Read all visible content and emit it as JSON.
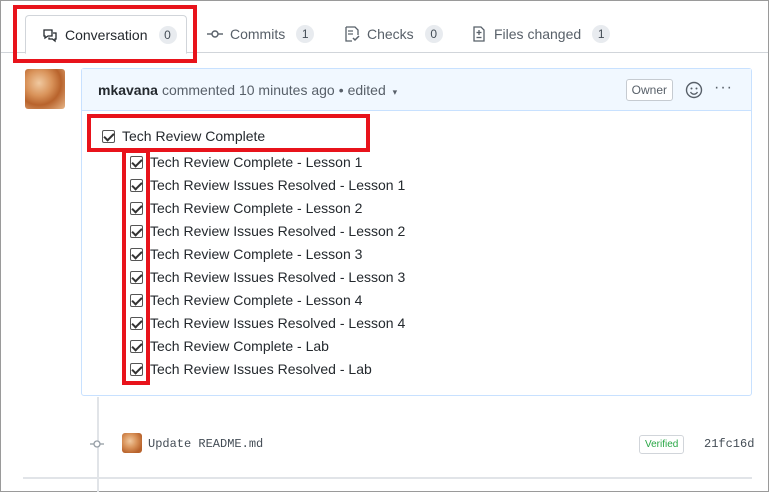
{
  "tabs": [
    {
      "label": "Conversation",
      "count": "0",
      "icon": "comment-discussion-icon"
    },
    {
      "label": "Commits",
      "count": "1",
      "icon": "git-commit-icon"
    },
    {
      "label": "Checks",
      "count": "0",
      "icon": "checklist-icon"
    },
    {
      "label": "Files changed",
      "count": "1",
      "icon": "file-diff-icon"
    }
  ],
  "comment": {
    "author": "mkavana",
    "meta": "commented 10 minutes ago",
    "separator": "•",
    "edited": "edited",
    "role_badge": "Owner",
    "dots": "···",
    "parent_task": {
      "label": "Tech Review Complete",
      "checked": true
    },
    "sub_tasks": [
      {
        "label": "Tech Review Complete - Lesson 1",
        "checked": true
      },
      {
        "label": "Tech Review Issues Resolved - Lesson 1",
        "checked": true
      },
      {
        "label": "Tech Review Complete - Lesson 2",
        "checked": true
      },
      {
        "label": "Tech Review Issues Resolved - Lesson 2",
        "checked": true
      },
      {
        "label": "Tech Review Complete - Lesson 3",
        "checked": true
      },
      {
        "label": "Tech Review Issues Resolved - Lesson 3",
        "checked": true
      },
      {
        "label": "Tech Review Complete - Lesson 4",
        "checked": true
      },
      {
        "label": "Tech Review Issues Resolved - Lesson 4",
        "checked": true
      },
      {
        "label": "Tech Review Complete - Lab",
        "checked": true
      },
      {
        "label": "Tech Review Issues Resolved - Lab",
        "checked": true
      }
    ]
  },
  "commit": {
    "message": "Update README.md",
    "verified": "Verified",
    "sha": "21fc16d"
  },
  "colors": {
    "highlight": "#e8131b",
    "verified": "#28a745",
    "header_bg": "#f1f8ff"
  }
}
